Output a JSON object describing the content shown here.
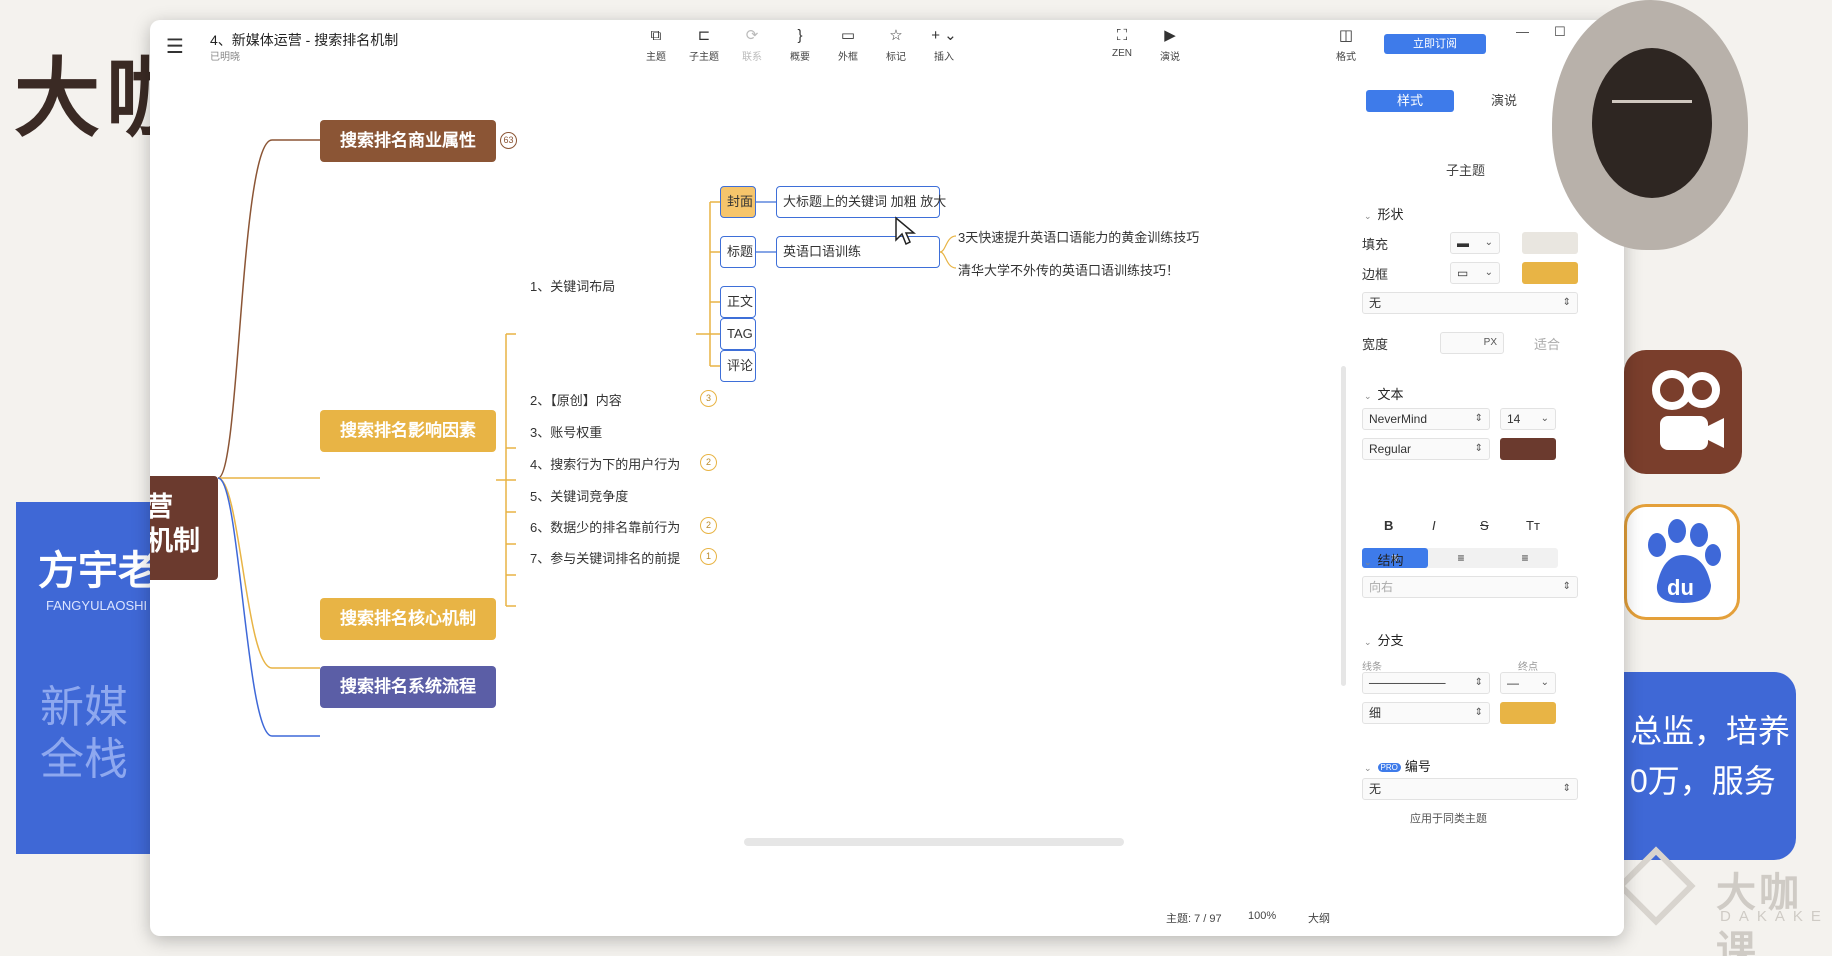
{
  "background": {
    "big_title": "大咖",
    "card_name": "方宇老",
    "card_pinyin": "FANGYULAOSHI",
    "card_sub": "新媒全栈",
    "right_line1": "总监，培养",
    "right_line2": "0万，服务",
    "logo_text": "大咖课",
    "logo_sub": "DAKAKE"
  },
  "toolbar": {
    "doc_title": "4、新媒体运营 - 搜索排名机制",
    "doc_status": "已明晓",
    "buttons": [
      {
        "icon": "⧉",
        "label": "主题"
      },
      {
        "icon": "⊏",
        "label": "子主题"
      },
      {
        "icon": "⟳",
        "label": "联系"
      },
      {
        "icon": "}",
        "label": "概要"
      },
      {
        "icon": "▭",
        "label": "外框"
      },
      {
        "icon": "☆",
        "label": "标记"
      },
      {
        "icon": "+ ⌄",
        "label": "插入"
      }
    ],
    "zen_label": "ZEN",
    "present_label": "演说",
    "format_label": "格式",
    "subscribe_label": "立即订阅"
  },
  "mindmap": {
    "root_label": "营\n机制",
    "main_nodes": [
      {
        "label": "搜索排名商业属性",
        "badge": "63"
      },
      {
        "label": "搜索排名影响因素"
      },
      {
        "label": "搜索排名核心机制"
      },
      {
        "label": "搜索排名系统流程"
      }
    ],
    "sub_items": [
      {
        "label": "1、关键词布局"
      },
      {
        "label": "2、【原创】内容",
        "badge": "3"
      },
      {
        "label": "3、账号权重"
      },
      {
        "label": "4、搜索行为下的用户行为",
        "badge": "2"
      },
      {
        "label": "5、关键词竞争度"
      },
      {
        "label": "6、数据少的排名靠前行为",
        "badge": "2"
      },
      {
        "label": "7、参与关键词排名的前提",
        "badge": "1"
      }
    ],
    "leaves": [
      "封面",
      "标题",
      "正文",
      "TAG",
      "评论"
    ],
    "leaf_details": {
      "cover": "大标题上的关键词 加粗 放大",
      "title": "英语口语训练"
    },
    "title_examples": [
      "3天快速提升英语口语能力的黄金训练技巧",
      "清华大学不外传的英语口语训练技巧！"
    ]
  },
  "status": {
    "topic_count": "主题: 7 / 97",
    "zoom": "100%",
    "outline": "大纲"
  },
  "panel": {
    "tab_style": "样式",
    "tab_present": "演说",
    "heading": "子主题",
    "shape": {
      "title": "形状",
      "fill_label": "填充",
      "border_label": "边框",
      "none_label": "无",
      "width_label": "宽度",
      "width_unit": "PX",
      "fit_label": "适合"
    },
    "text": {
      "title": "文本",
      "font": "NeverMind",
      "size": "14",
      "weight": "Regular",
      "bold": "B",
      "italic": "I",
      "strike": "S",
      "case": "Tт"
    },
    "structure": {
      "title": "结构",
      "direction": "向右"
    },
    "branch": {
      "title": "分支",
      "line_label": "线条",
      "end_label": "终点",
      "thickness": "细"
    },
    "numbering": {
      "title": "编号",
      "pro": "PRO",
      "value": "无",
      "apply": "应用于同类主题"
    }
  },
  "colors": {
    "brown": "#8b5535",
    "gold": "#e8b445",
    "indigo": "#5b5ea6",
    "root": "#6b3a2e",
    "accent": "#3e7bea",
    "text_color_swatch": "#6b3a2e",
    "branch_swatch": "#e8b445"
  }
}
